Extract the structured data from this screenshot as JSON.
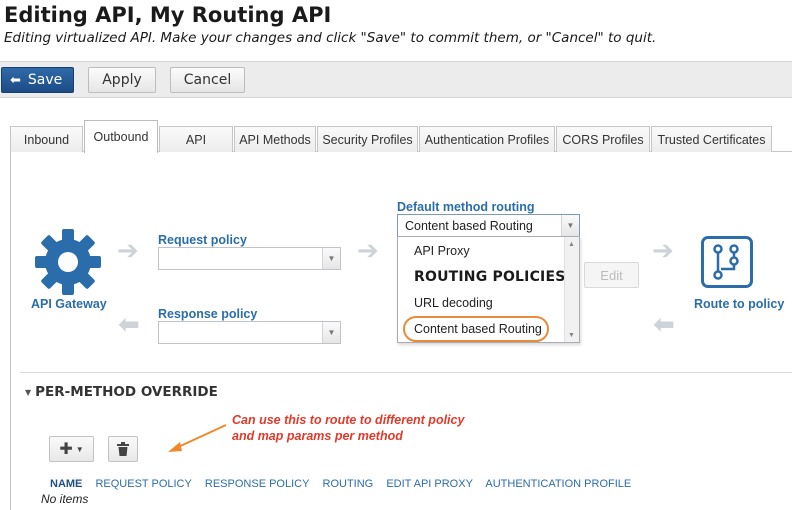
{
  "page": {
    "title": "Editing API, My Routing API",
    "subtitle": "Editing virtualized API. Make your changes and click \"Save\" to commit them, or \"Cancel\" to quit."
  },
  "toolbar": {
    "save_label": "Save",
    "apply_label": "Apply",
    "cancel_label": "Cancel"
  },
  "tabs": [
    {
      "label": "Inbound"
    },
    {
      "label": "Outbound",
      "active": true
    },
    {
      "label": "API"
    },
    {
      "label": "API Methods"
    },
    {
      "label": "Security Profiles"
    },
    {
      "label": "Authentication Profiles"
    },
    {
      "label": "CORS Profiles"
    },
    {
      "label": "Trusted Certificates"
    }
  ],
  "flow": {
    "gateway_label": "API Gateway",
    "request_policy_label": "Request policy",
    "request_policy_value": "",
    "response_policy_label": "Response policy",
    "response_policy_value": "",
    "default_routing_label": "Default method routing",
    "default_routing_value": "Content based Routing",
    "dropdown_options": [
      "API Proxy",
      "ROUTING POLICIES",
      "URL decoding",
      "Content based Routing"
    ],
    "edit_label": "Edit",
    "route_label": "Route to policy"
  },
  "override": {
    "heading": "PER-METHOD OVERRIDE",
    "annotation_line1": "Can use this to route to different policy",
    "annotation_line2": "and map params per method",
    "columns": [
      "NAME",
      "REQUEST POLICY",
      "RESPONSE POLICY",
      "ROUTING",
      "EDIT API PROXY",
      "AUTHENTICATION PROFILE"
    ],
    "empty_text": "No items"
  },
  "colors": {
    "accent": "#2b6dab",
    "save": "#1c4c86",
    "annotation": "#e23a2a",
    "highlight": "#e98b3c"
  }
}
